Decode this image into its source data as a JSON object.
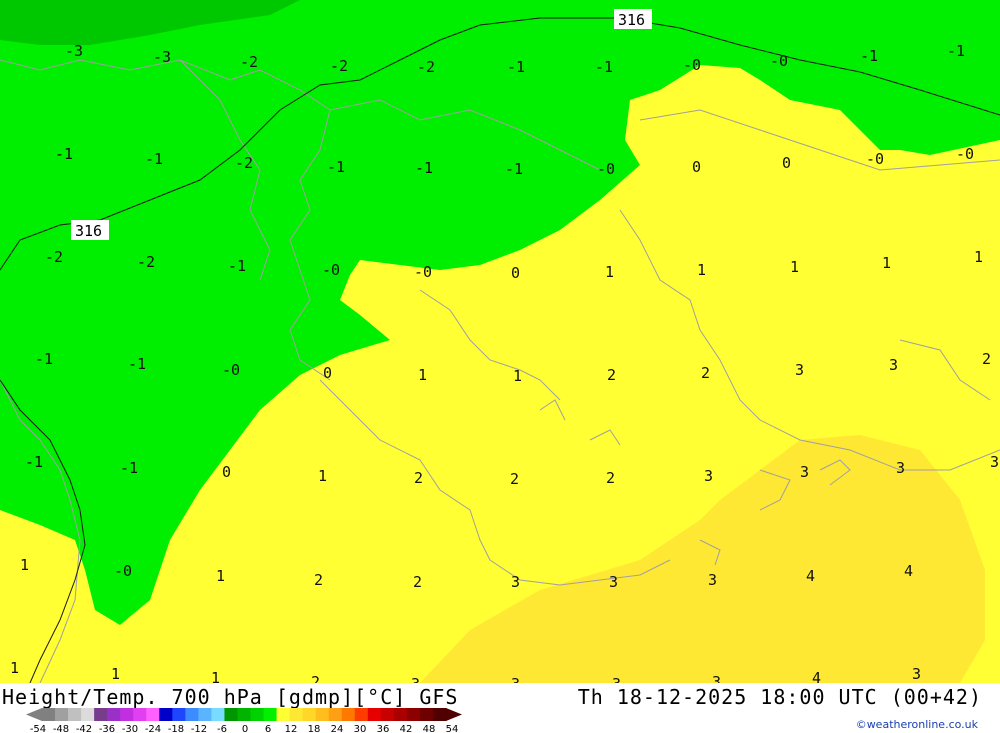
{
  "title": "Height/Temp. 700 hPa [gdmp][°C] GFS",
  "valid_time": "Th 18-12-2025 18:00 UTC (00+42)",
  "credit": "©weatheronline.co.uk",
  "colors": {
    "green": "#00ee00",
    "dark_green": "#00c800",
    "yellow": "#ffff33",
    "yellow_dark": "#ffe833",
    "coast": "#a0a0a0",
    "contour": "#1a1a1a"
  },
  "height_contours": [
    "316",
    "316"
  ],
  "temperature_labels": [
    "-3",
    "-3",
    "-2",
    "-2",
    "-2",
    "-1",
    "-1",
    "-0",
    "-0",
    "-1",
    "-1",
    "-1",
    "-1",
    "-2",
    "-1",
    "-1",
    "-1",
    "-0",
    "0",
    "0",
    "-0",
    "-0",
    "-2",
    "-2",
    "-1",
    "-0",
    "-0",
    "0",
    "1",
    "1",
    "1",
    "1",
    "1",
    "-1",
    "-1",
    "-0",
    "0",
    "1",
    "1",
    "2",
    "2",
    "3",
    "3",
    "2",
    "-1",
    "-1",
    "0",
    "1",
    "2",
    "2",
    "2",
    "3",
    "3",
    "3",
    "3",
    "1",
    "-0",
    "1",
    "2",
    "2",
    "3",
    "3",
    "3",
    "4",
    "4",
    "1",
    "1",
    "1",
    "2",
    "3",
    "3",
    "3",
    "3",
    "4",
    "3"
  ],
  "scale": {
    "ticks": [
      "-54",
      "-48",
      "-42",
      "-36",
      "-30",
      "-24",
      "-18",
      "-12",
      "-6",
      "0",
      "6",
      "12",
      "18",
      "24",
      "30",
      "36",
      "42",
      "48",
      "54"
    ],
    "colors": [
      "#808080",
      "#a0a0a0",
      "#c0c0c0",
      "#dcdcdc",
      "#783c8c",
      "#9b30c8",
      "#c030e0",
      "#e040f0",
      "#ff60ff",
      "#0000c8",
      "#1e46ff",
      "#3c8cff",
      "#5ab4ff",
      "#78dcff",
      "#009600",
      "#00b400",
      "#00d200",
      "#00f000",
      "#ffff33",
      "#ffe833",
      "#ffd728",
      "#ffbe1e",
      "#ffa014",
      "#ff7800",
      "#ff3c00",
      "#e60000",
      "#c80000",
      "#aa0000",
      "#8c0000",
      "#6e0000",
      "#500000"
    ]
  }
}
